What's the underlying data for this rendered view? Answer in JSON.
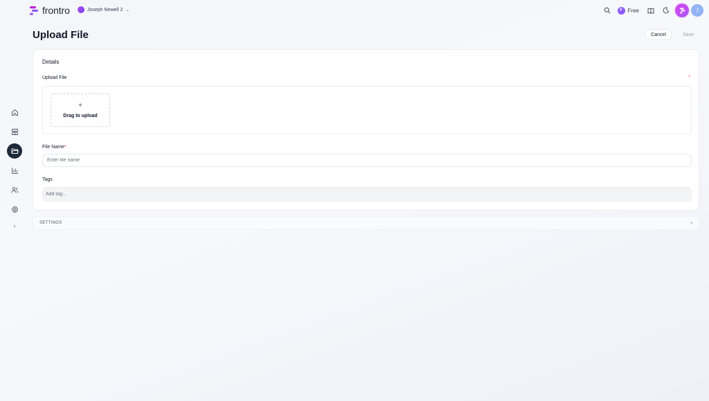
{
  "app": {
    "name": "frontro"
  },
  "workspace": {
    "name": "Joseph Newell 2"
  },
  "topbar": {
    "plan_label": "Free",
    "plan_badge": "F",
    "user_initial": "J"
  },
  "sidebar": {
    "items": [
      {
        "name": "home",
        "icon": "home-icon",
        "active": false
      },
      {
        "name": "layout",
        "icon": "layout-icon",
        "active": false
      },
      {
        "name": "files",
        "icon": "folder-icon",
        "active": true
      },
      {
        "name": "analytics",
        "icon": "bar-chart-icon",
        "active": false
      },
      {
        "name": "users",
        "icon": "users-icon",
        "active": false
      },
      {
        "name": "settings",
        "icon": "gear-icon",
        "active": false
      }
    ],
    "expand_icon": "chevron-right-icon"
  },
  "page": {
    "title": "Upload File",
    "cancel_label": "Cancel",
    "save_label": "Save"
  },
  "form": {
    "section_title": "Details",
    "upload_label": "Upload File",
    "upload_required_mark": "*",
    "dropzone_plus": "+",
    "dropzone_text": "Drag to upload",
    "file_name_label": "File Name",
    "file_name_required_mark": "*",
    "file_name_placeholder": "Enter file name",
    "file_name_value": "",
    "tags_label": "Tags",
    "tags_placeholder": "Add tag..."
  },
  "settings_section": {
    "label": "SETTINGS"
  },
  "colors": {
    "accent": "#8b5cf6",
    "active_nav": "#1e293b",
    "required": "#ef4444"
  }
}
